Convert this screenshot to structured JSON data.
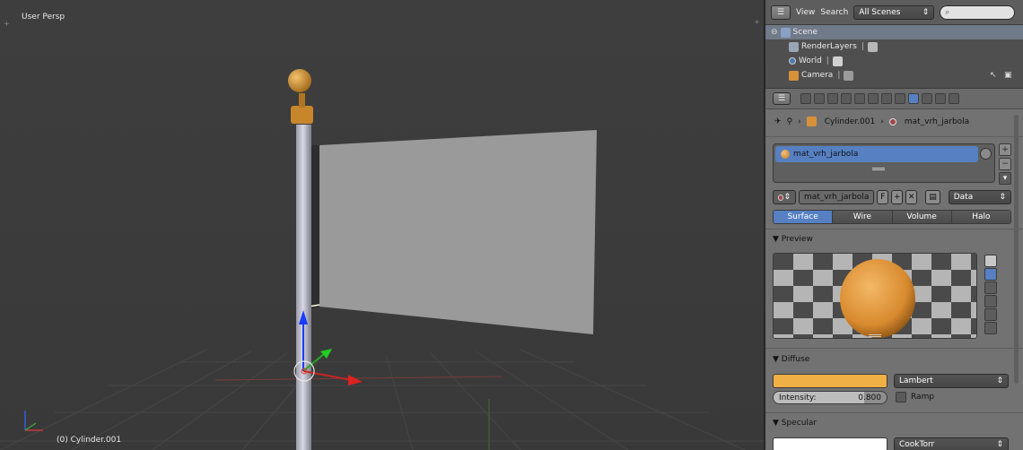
{
  "viewport": {
    "view_label": "User Persp",
    "object_info": "(0) Cylinder.001"
  },
  "outliner": {
    "menu_view": "View",
    "menu_search": "Search",
    "scene_filter": "All Scenes",
    "rows": [
      {
        "label": "Scene"
      },
      {
        "label": "RenderLayers"
      },
      {
        "label": "World"
      },
      {
        "label": "Camera"
      }
    ]
  },
  "properties": {
    "breadcrumb": {
      "object": "Cylinder.001",
      "material": "mat_vrh_jarbola"
    },
    "slot_item": "mat_vrh_jarbola",
    "datablock": {
      "name": "mat_vrh_jarbola",
      "fake_user": "F",
      "link": "Data"
    },
    "tabs": [
      {
        "label": "Surface",
        "active": true
      },
      {
        "label": "Wire",
        "active": false
      },
      {
        "label": "Volume",
        "active": false
      },
      {
        "label": "Halo",
        "active": false
      }
    ],
    "preview_title": "▼ Preview",
    "diffuse_title": "▼ Diffuse",
    "diffuse": {
      "color": "#f0b045",
      "shader": "Lambert",
      "intensity_label": "Intensity:",
      "intensity_value": "0.800",
      "intensity_fraction": 0.8,
      "ramp_label": "Ramp"
    },
    "specular_title": "▼ Specular",
    "specular": {
      "color": "#ffffff",
      "shader": "CookTorr"
    }
  },
  "colors": {
    "accent": "#5680c2",
    "viewport_bg": "#3d3d3d",
    "panel_bg": "#727272"
  }
}
